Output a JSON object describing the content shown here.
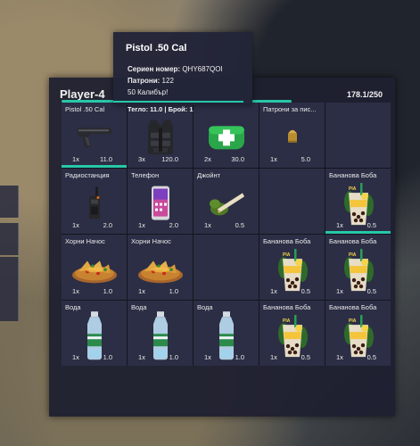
{
  "inventory": {
    "player_name": "Player-4",
    "weight": "178.1/250",
    "slots": [
      {
        "name": "Pistol .50 Cal",
        "count": "1x",
        "weight": "11.0",
        "icon": "pistol-icon"
      },
      {
        "name": "",
        "count": "3x",
        "weight": "120.0",
        "icon": "armor-vest-icon"
      },
      {
        "name": "",
        "count": "2x",
        "weight": "30.0",
        "icon": "medkit-icon"
      },
      {
        "name": "Патрони за пис...",
        "count": "1x",
        "weight": "5.0",
        "icon": "bullet-icon"
      },
      {
        "name": "",
        "count": "",
        "weight": "",
        "icon": ""
      },
      {
        "name": "Радиостанция",
        "count": "1x",
        "weight": "2.0",
        "icon": "radio-icon"
      },
      {
        "name": "Телефон",
        "count": "1x",
        "weight": "2.0",
        "icon": "phone-icon"
      },
      {
        "name": "Джойнт",
        "count": "1x",
        "weight": "0.5",
        "icon": "joint-icon"
      },
      {
        "name": "",
        "count": "",
        "weight": "",
        "icon": ""
      },
      {
        "name": "Бананова Боба",
        "count": "1x",
        "weight": "0.5",
        "icon": "boba-drink-icon"
      },
      {
        "name": "Хорни Начос",
        "count": "1x",
        "weight": "1.0",
        "icon": "nachos-icon"
      },
      {
        "name": "Хорни Начос",
        "count": "1x",
        "weight": "1.0",
        "icon": "nachos-icon"
      },
      {
        "name": "",
        "count": "",
        "weight": "",
        "icon": ""
      },
      {
        "name": "Бананова Боба",
        "count": "1x",
        "weight": "0.5",
        "icon": "boba-drink-icon"
      },
      {
        "name": "Бананова Боба",
        "count": "1x",
        "weight": "0.5",
        "icon": "boba-drink-icon"
      },
      {
        "name": "Вода",
        "count": "1x",
        "weight": "1.0",
        "icon": "water-bottle-icon"
      },
      {
        "name": "Вода",
        "count": "1x",
        "weight": "1.0",
        "icon": "water-bottle-icon"
      },
      {
        "name": "Вода",
        "count": "1x",
        "weight": "1.0",
        "icon": "water-bottle-icon"
      },
      {
        "name": "Бананова Боба",
        "count": "1x",
        "weight": "0.5",
        "icon": "boba-drink-icon"
      },
      {
        "name": "Бананова Боба",
        "count": "1x",
        "weight": "0.5",
        "icon": "boba-drink-icon"
      }
    ]
  },
  "tooltip": {
    "title": "Pistol .50 Cal",
    "serial_label": "Сериен номер:",
    "serial_value": "QHY687QOI",
    "ammo_label": "Патрони:",
    "ammo_value": "122",
    "caliber": "50 Калибър!",
    "info": "Тегло: 11.0 | Брой: 1"
  },
  "colors": {
    "accent": "#26c9a7",
    "panel": "#1e1f30",
    "slot": "#2c2e45"
  }
}
